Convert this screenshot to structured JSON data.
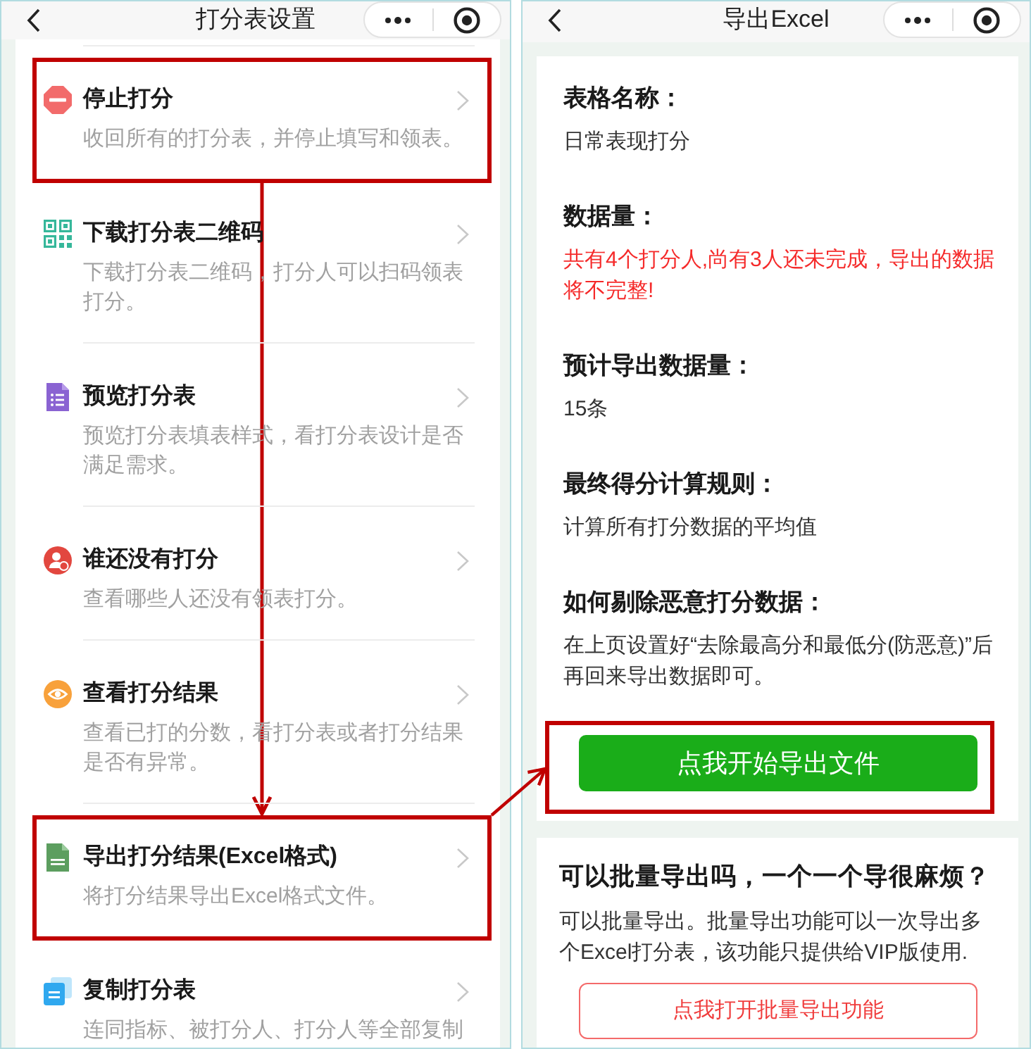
{
  "left_screen": {
    "title": "打分表设置",
    "items": [
      {
        "kind": "stop",
        "title": "停止打分",
        "description": "收回所有的打分表，并停止填写和领表。",
        "highlighted": true
      },
      {
        "kind": "qrcode",
        "title": "下载打分表二维码",
        "description": "下载打分表二维码，打分人可以扫码领表打分。",
        "highlighted": false
      },
      {
        "kind": "preview",
        "title": "预览打分表",
        "description": "预览打分表填表样式，看打分表设计是否满足需求。",
        "highlighted": false
      },
      {
        "kind": "pending",
        "title": "谁还没有打分",
        "description": "查看哪些人还没有领表打分。",
        "highlighted": false
      },
      {
        "kind": "results",
        "title": "查看打分结果",
        "description": "查看已打的分数，看打分表或者打分结果是否有异常。",
        "highlighted": false
      },
      {
        "kind": "excel",
        "title": "导出打分结果(Excel格式)",
        "description": "将打分结果导出Excel格式文件。",
        "highlighted": true
      },
      {
        "kind": "copy",
        "title": "复制打分表",
        "description": "连同指标、被打分人、打分人等全部复制",
        "highlighted": false
      }
    ]
  },
  "right_screen": {
    "title": "导出Excel",
    "fields": [
      {
        "label": "表格名称：",
        "value": "日常表现打分",
        "warning": false
      },
      {
        "label": "数据量：",
        "value": "共有4个打分人,尚有3人还未完成，导出的数据将不完整!",
        "warning": true
      },
      {
        "label": "预计导出数据量：",
        "value": "15条",
        "warning": false
      },
      {
        "label": "最终得分计算规则：",
        "value": "计算所有打分数据的平均值",
        "warning": false
      },
      {
        "label": "如何剔除恶意打分数据：",
        "value": "在上页设置好“去除最高分和最低分(防恶意)”后再回来导出数据即可。",
        "warning": false
      }
    ],
    "export_button": {
      "label": "点我开始导出文件",
      "highlighted": true
    },
    "batch_card": {
      "title": "可以批量导出吗，一个一个导很麻烦？",
      "description": "可以批量导出。批量导出功能可以一次导出多个Excel打分表，该功能只提供给VIP版使用.",
      "button": "点我打开批量导出功能"
    }
  }
}
